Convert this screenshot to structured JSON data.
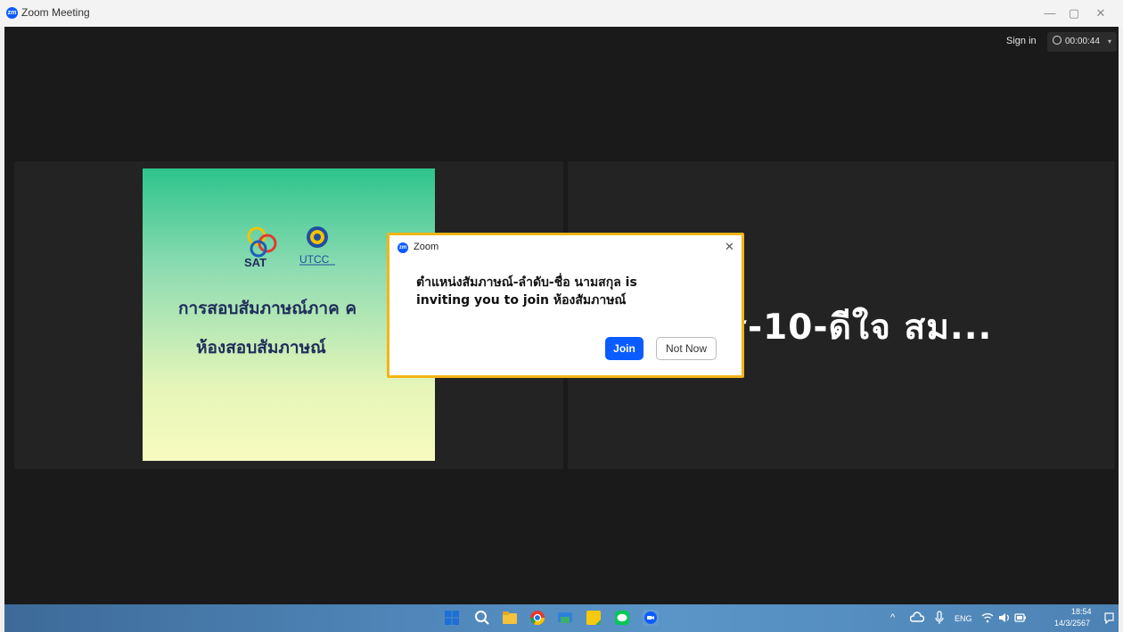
{
  "window": {
    "title": "Zoom Meeting",
    "app_logo": "zm",
    "minimize": "—",
    "maximize": "▢",
    "close": "✕"
  },
  "toolbar": {
    "sign_in": "Sign in",
    "timer": "00:00:44",
    "timer_caret": "▾"
  },
  "slide": {
    "sat_label": "SAT",
    "utcc_label": "UTCC",
    "title": "การสอบสัมภาษณ์ภาค ค",
    "room": "ห้องสอบสัมภาษณ์"
  },
  "participant": {
    "name_text": "ร-10-ดีใจ สม..."
  },
  "dialog": {
    "logo": "zm",
    "title": "Zoom",
    "close": "✕",
    "message_line1": "ตำแหน่งสัมภาษณ์-ลำดับ-ชื่อ นามสกุล is",
    "message_line2": "inviting you to join ห้องสัมภาษณ์",
    "join_label": "Join",
    "not_now_label": "Not Now"
  },
  "taskbar": {
    "tray_caret": "^",
    "language": "ENG",
    "time": "18:54",
    "date": "14/3/2567"
  },
  "colors": {
    "zoom_blue": "#0b5cff",
    "dialog_border": "#f2b518",
    "meeting_bg": "#1a1a1a",
    "tile_bg": "#232323"
  }
}
